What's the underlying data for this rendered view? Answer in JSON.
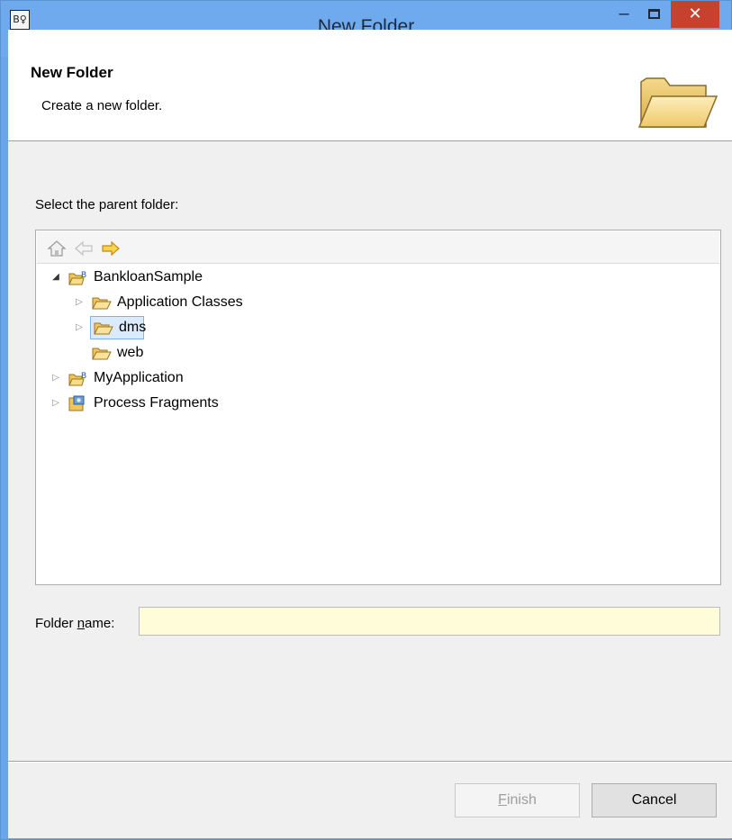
{
  "window": {
    "title": "New Folder",
    "app_icon_glyph": "B♀",
    "minimize_glyph": "–",
    "close_glyph": "✕"
  },
  "header": {
    "title": "New Folder",
    "description": "Create a new folder.",
    "icon": "open-folder-icon"
  },
  "parent_label": "Select the parent folder:",
  "tree_toolbar": {
    "home_icon": "home-icon",
    "back_icon": "back-arrow-icon",
    "forward_icon": "forward-arrow-icon"
  },
  "tree": {
    "items": [
      {
        "label": "BankloanSample",
        "icon": "project-icon",
        "expanded": true
      },
      {
        "label": "Application Classes",
        "icon": "folder-icon",
        "expanded": false
      },
      {
        "label": "dms",
        "icon": "folder-icon",
        "expanded": false,
        "selected": true
      },
      {
        "label": "web",
        "icon": "folder-icon"
      },
      {
        "label": "MyApplication",
        "icon": "project-icon",
        "expanded": false
      },
      {
        "label": "Process Fragments",
        "icon": "fragments-icon",
        "expanded": false
      }
    ]
  },
  "folder_name": {
    "label_prefix": "Folder ",
    "label_mnemonic": "n",
    "label_suffix": "ame:",
    "value": "",
    "placeholder": ""
  },
  "buttons": {
    "finish_mnemonic": "F",
    "finish_rest": "inish",
    "cancel": "Cancel"
  },
  "colors": {
    "title_bar": "#6fa9ee",
    "close_button": "#c7412f",
    "input_background": "#fffcd9",
    "selection": "#dcebfc"
  }
}
